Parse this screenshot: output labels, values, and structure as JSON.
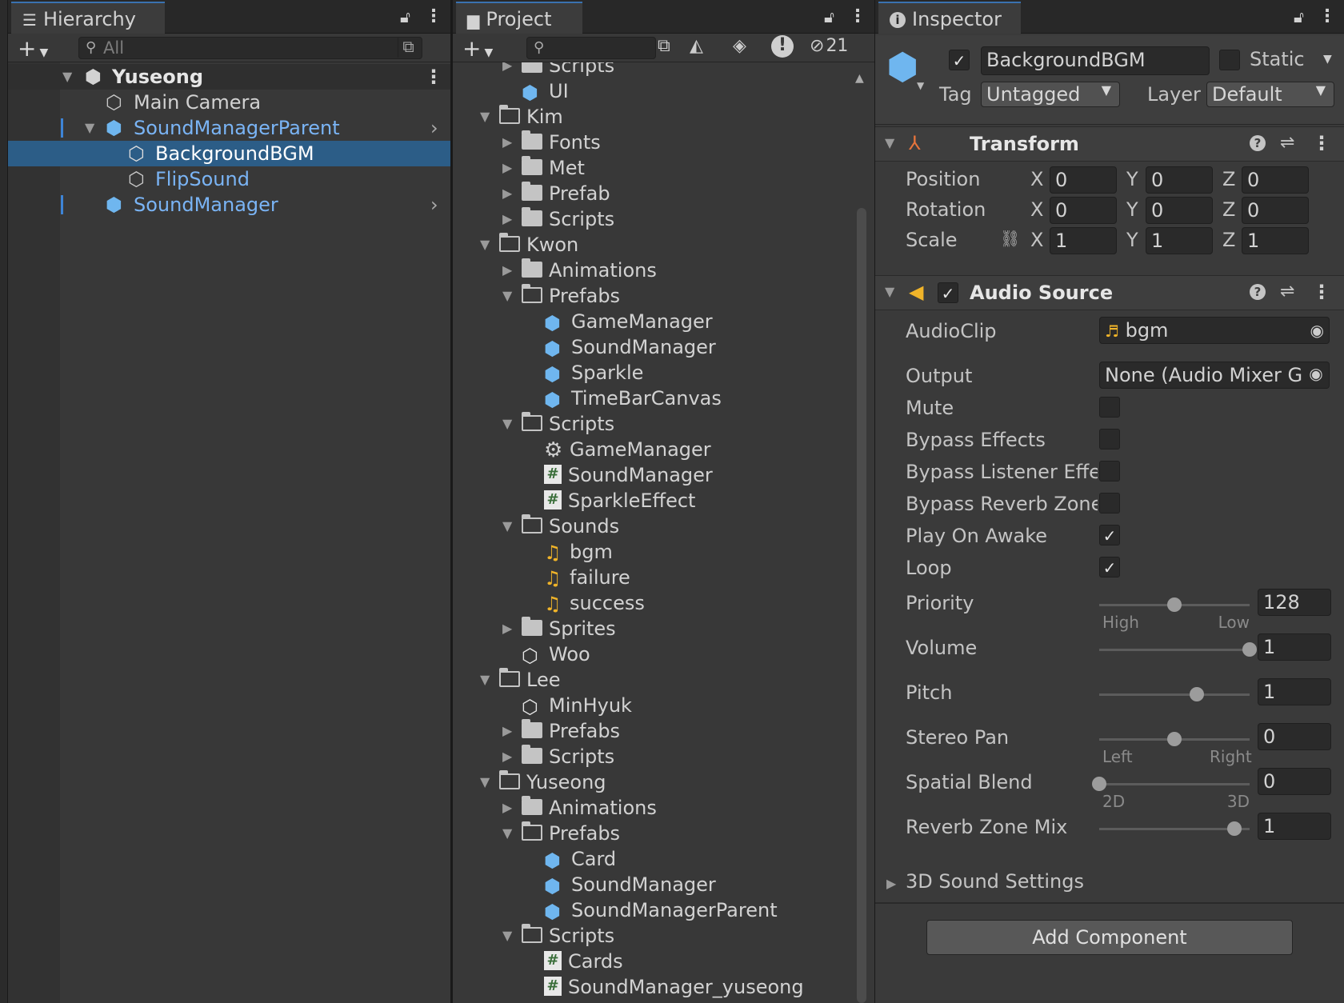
{
  "hierarchy": {
    "tab": "Hierarchy",
    "search_placeholder": "All",
    "scene": "Yuseong",
    "items": [
      "Main Camera",
      "SoundManagerParent",
      "BackgroundBGM",
      "FlipSound",
      "SoundManager"
    ]
  },
  "project": {
    "tab": "Project",
    "hidden_count": "21",
    "tree": [
      {
        "label": "Scripts",
        "kind": "folder",
        "depth": 1,
        "exp": "closed"
      },
      {
        "label": "UI",
        "kind": "prefab",
        "depth": 1,
        "exp": "none"
      },
      {
        "label": "Kim",
        "kind": "folder-open",
        "depth": 0,
        "exp": "open"
      },
      {
        "label": "Fonts",
        "kind": "folder",
        "depth": 1,
        "exp": "closed"
      },
      {
        "label": "Met",
        "kind": "folder",
        "depth": 1,
        "exp": "closed"
      },
      {
        "label": "Prefab",
        "kind": "folder",
        "depth": 1,
        "exp": "closed"
      },
      {
        "label": "Scripts",
        "kind": "folder",
        "depth": 1,
        "exp": "closed"
      },
      {
        "label": "Kwon",
        "kind": "folder-open",
        "depth": 0,
        "exp": "open"
      },
      {
        "label": "Animations",
        "kind": "folder",
        "depth": 1,
        "exp": "closed"
      },
      {
        "label": "Prefabs",
        "kind": "folder-open",
        "depth": 1,
        "exp": "open"
      },
      {
        "label": "GameManager",
        "kind": "prefab",
        "depth": 2,
        "exp": "none"
      },
      {
        "label": "SoundManager",
        "kind": "prefab",
        "depth": 2,
        "exp": "none"
      },
      {
        "label": "Sparkle",
        "kind": "prefab",
        "depth": 2,
        "exp": "none"
      },
      {
        "label": "TimeBarCanvas",
        "kind": "prefab",
        "depth": 2,
        "exp": "none"
      },
      {
        "label": "Scripts",
        "kind": "folder-open",
        "depth": 1,
        "exp": "open"
      },
      {
        "label": "GameManager",
        "kind": "gear",
        "depth": 2,
        "exp": "none"
      },
      {
        "label": "SoundManager",
        "kind": "script",
        "depth": 2,
        "exp": "none"
      },
      {
        "label": "SparkleEffect",
        "kind": "script",
        "depth": 2,
        "exp": "none"
      },
      {
        "label": "Sounds",
        "kind": "folder-open",
        "depth": 1,
        "exp": "open"
      },
      {
        "label": "bgm",
        "kind": "audio",
        "depth": 2,
        "exp": "none"
      },
      {
        "label": "failure",
        "kind": "audio",
        "depth": 2,
        "exp": "none"
      },
      {
        "label": "success",
        "kind": "audio",
        "depth": 2,
        "exp": "none"
      },
      {
        "label": "Sprites",
        "kind": "folder",
        "depth": 1,
        "exp": "closed"
      },
      {
        "label": "Woo",
        "kind": "unity",
        "depth": 1,
        "exp": "none"
      },
      {
        "label": "Lee",
        "kind": "folder-open",
        "depth": 0,
        "exp": "open"
      },
      {
        "label": "MinHyuk",
        "kind": "unity",
        "depth": 1,
        "exp": "none"
      },
      {
        "label": "Prefabs",
        "kind": "folder",
        "depth": 1,
        "exp": "closed"
      },
      {
        "label": "Scripts",
        "kind": "folder",
        "depth": 1,
        "exp": "closed"
      },
      {
        "label": "Yuseong",
        "kind": "folder-open",
        "depth": 0,
        "exp": "open"
      },
      {
        "label": "Animations",
        "kind": "folder",
        "depth": 1,
        "exp": "closed"
      },
      {
        "label": "Prefabs",
        "kind": "folder-open",
        "depth": 1,
        "exp": "open"
      },
      {
        "label": "Card",
        "kind": "prefab",
        "depth": 2,
        "exp": "none"
      },
      {
        "label": "SoundManager",
        "kind": "prefab",
        "depth": 2,
        "exp": "none"
      },
      {
        "label": "SoundManagerParent",
        "kind": "prefab",
        "depth": 2,
        "exp": "none"
      },
      {
        "label": "Scripts",
        "kind": "folder-open",
        "depth": 1,
        "exp": "open"
      },
      {
        "label": "Cards",
        "kind": "script",
        "depth": 2,
        "exp": "none"
      },
      {
        "label": "SoundManager_yuseong",
        "kind": "script",
        "depth": 2,
        "exp": "none"
      }
    ]
  },
  "inspector": {
    "tab": "Inspector",
    "object_name": "BackgroundBGM",
    "active": true,
    "static_label": "Static",
    "tag_label": "Tag",
    "tag_value": "Untagged",
    "layer_label": "Layer",
    "layer_value": "Default",
    "transform": {
      "title": "Transform",
      "position_label": "Position",
      "rotation_label": "Rotation",
      "scale_label": "Scale",
      "axes": [
        "X",
        "Y",
        "Z"
      ],
      "position": [
        "0",
        "0",
        "0"
      ],
      "rotation": [
        "0",
        "0",
        "0"
      ],
      "scale": [
        "1",
        "1",
        "1"
      ]
    },
    "audio": {
      "title": "Audio Source",
      "audioclip_label": "AudioClip",
      "audioclip_value": "bgm",
      "output_label": "Output",
      "output_value": "None (Audio Mixer Grou",
      "mute_label": "Mute",
      "bypass_effects_label": "Bypass Effects",
      "bypass_listener_label": "Bypass Listener Effec",
      "bypass_reverb_label": "Bypass Reverb Zones",
      "play_on_awake_label": "Play On Awake",
      "loop_label": "Loop",
      "checks": {
        "mute": false,
        "bypass_effects": false,
        "bypass_listener": false,
        "bypass_reverb": false,
        "play_on_awake": true,
        "loop": true
      },
      "priority_label": "Priority",
      "priority_value": "128",
      "priority_level": 0.5,
      "priority_min": "High",
      "priority_max": "Low",
      "volume_label": "Volume",
      "volume_value": "1",
      "volume_level": 1.0,
      "pitch_label": "Pitch",
      "pitch_value": "1",
      "pitch_level": 0.65,
      "stereo_label": "Stereo Pan",
      "stereo_value": "0",
      "stereo_level": 0.5,
      "stereo_min": "Left",
      "stereo_max": "Right",
      "spatial_label": "Spatial Blend",
      "spatial_value": "0",
      "spatial_level": 0.0,
      "spatial_min": "2D",
      "spatial_max": "3D",
      "reverb_label": "Reverb Zone Mix",
      "reverb_value": "1",
      "reverb_level": 0.9,
      "sound3d_label": "3D Sound Settings"
    },
    "add_component": "Add Component"
  }
}
